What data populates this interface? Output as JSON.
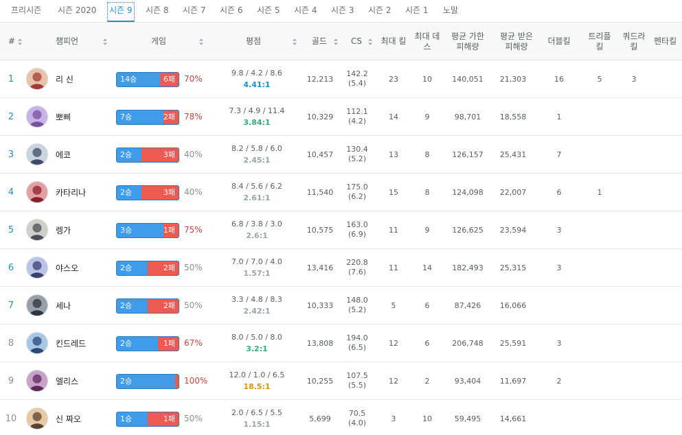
{
  "tabs": [
    {
      "label": "프리시즌",
      "active": false
    },
    {
      "label": "시즌 2020",
      "active": false
    },
    {
      "label": "시즌 9",
      "active": true
    },
    {
      "label": "시즌 8",
      "active": false
    },
    {
      "label": "시즌 7",
      "active": false
    },
    {
      "label": "시즌 6",
      "active": false
    },
    {
      "label": "시즌 5",
      "active": false
    },
    {
      "label": "시즌 4",
      "active": false
    },
    {
      "label": "시즌 3",
      "active": false
    },
    {
      "label": "시즌 2",
      "active": false
    },
    {
      "label": "시즌 1",
      "active": false
    },
    {
      "label": "노말",
      "active": false
    }
  ],
  "headers": {
    "rank": "#",
    "champion": "챔피언",
    "games": "게임",
    "rating": "평점",
    "gold": "골드",
    "cs": "CS",
    "max_kill": "최대 킬",
    "max_death": "최대 데스",
    "avg_dealt": "평균 가한 피해량",
    "avg_taken": "평균 받은 피해량",
    "double": "더블킬",
    "triple": "트리플킬",
    "quadra": "쿼드라킬",
    "penta": "펜타킬"
  },
  "icons": {
    "sort": "sort-arrows-icon"
  },
  "colors": {
    "accent": "#1f8ecd",
    "win": "#3f9cea",
    "loss": "#ee5a52",
    "winrate_high": "#c6443e",
    "kda_green": "#2daf7f",
    "kda_orange": "#e19205"
  },
  "rows": [
    {
      "rank": "1",
      "champion": "리 신",
      "wins": 14,
      "losses": 6,
      "win_label": "14승",
      "loss_label": "6패",
      "winrate": "70%",
      "kda": "9.8 / 4.2 / 8.6",
      "ratio": "4.41:1",
      "ratio_color": "blue",
      "gold": "12,213",
      "cs": "142.2",
      "cs_per_min": "(5.4)",
      "max_kill": "23",
      "max_death": "10",
      "avg_dealt": "140,051",
      "avg_taken": "21,303",
      "double": "16",
      "triple": "5",
      "quadra": "3",
      "penta": ""
    },
    {
      "rank": "2",
      "champion": "뽀삐",
      "wins": 7,
      "losses": 2,
      "win_label": "7승",
      "loss_label": "2패",
      "winrate": "78%",
      "kda": "7.3 / 4.9 / 11.4",
      "ratio": "3.84:1",
      "ratio_color": "green",
      "gold": "10,329",
      "cs": "112.1",
      "cs_per_min": "(4.2)",
      "max_kill": "14",
      "max_death": "9",
      "avg_dealt": "98,701",
      "avg_taken": "18,558",
      "double": "1",
      "triple": "",
      "quadra": "",
      "penta": ""
    },
    {
      "rank": "3",
      "champion": "에코",
      "wins": 2,
      "losses": 3,
      "win_label": "2승",
      "loss_label": "3패",
      "winrate": "40%",
      "kda": "8.2 / 5.8 / 6.0",
      "ratio": "2.45:1",
      "ratio_color": "gray",
      "gold": "10,457",
      "cs": "130.4",
      "cs_per_min": "(5.2)",
      "max_kill": "13",
      "max_death": "8",
      "avg_dealt": "126,157",
      "avg_taken": "25,431",
      "double": "7",
      "triple": "",
      "quadra": "",
      "penta": ""
    },
    {
      "rank": "4",
      "champion": "카타리나",
      "wins": 2,
      "losses": 3,
      "win_label": "2승",
      "loss_label": "3패",
      "winrate": "40%",
      "kda": "8.4 / 5.6 / 6.2",
      "ratio": "2.61:1",
      "ratio_color": "gray",
      "gold": "11,540",
      "cs": "175.0",
      "cs_per_min": "(6.2)",
      "max_kill": "15",
      "max_death": "8",
      "avg_dealt": "124,098",
      "avg_taken": "22,007",
      "double": "6",
      "triple": "1",
      "quadra": "",
      "penta": ""
    },
    {
      "rank": "5",
      "champion": "렝가",
      "wins": 3,
      "losses": 1,
      "win_label": "3승",
      "loss_label": "1패",
      "winrate": "75%",
      "kda": "6.8 / 3.8 / 3.0",
      "ratio": "2.6:1",
      "ratio_color": "gray",
      "gold": "10,575",
      "cs": "163.0",
      "cs_per_min": "(6.9)",
      "max_kill": "11",
      "max_death": "9",
      "avg_dealt": "126,625",
      "avg_taken": "23,594",
      "double": "3",
      "triple": "",
      "quadra": "",
      "penta": ""
    },
    {
      "rank": "6",
      "champion": "야스오",
      "wins": 2,
      "losses": 2,
      "win_label": "2승",
      "loss_label": "2패",
      "winrate": "50%",
      "kda": "7.0 / 7.0 / 4.0",
      "ratio": "1.57:1",
      "ratio_color": "gray",
      "gold": "13,416",
      "cs": "220.8",
      "cs_per_min": "(7.6)",
      "max_kill": "11",
      "max_death": "14",
      "avg_dealt": "182,493",
      "avg_taken": "25,315",
      "double": "3",
      "triple": "",
      "quadra": "",
      "penta": ""
    },
    {
      "rank": "7",
      "champion": "세나",
      "wins": 2,
      "losses": 2,
      "win_label": "2승",
      "loss_label": "2패",
      "winrate": "50%",
      "kda": "3.3 / 4.8 / 8.3",
      "ratio": "2.42:1",
      "ratio_color": "gray",
      "gold": "10,333",
      "cs": "148.0",
      "cs_per_min": "(5.2)",
      "max_kill": "5",
      "max_death": "6",
      "avg_dealt": "87,426",
      "avg_taken": "16,066",
      "double": "",
      "triple": "",
      "quadra": "",
      "penta": ""
    },
    {
      "rank": "8",
      "champion": "킨드레드",
      "wins": 2,
      "losses": 1,
      "win_label": "2승",
      "loss_label": "1패",
      "winrate": "67%",
      "kda": "8.0 / 5.0 / 8.0",
      "ratio": "3.2:1",
      "ratio_color": "green",
      "gold": "13,808",
      "cs": "194.0",
      "cs_per_min": "(6.5)",
      "max_kill": "12",
      "max_death": "6",
      "avg_dealt": "206,748",
      "avg_taken": "25,591",
      "double": "3",
      "triple": "",
      "quadra": "",
      "penta": ""
    },
    {
      "rank": "9",
      "champion": "엘리스",
      "wins": 2,
      "losses": 0,
      "win_label": "2승",
      "loss_label": "",
      "winrate": "100%",
      "kda": "12.0 / 1.0 / 6.5",
      "ratio": "18.5:1",
      "ratio_color": "orange",
      "gold": "10,255",
      "cs": "107.5",
      "cs_per_min": "(5.5)",
      "max_kill": "12",
      "max_death": "2",
      "avg_dealt": "93,404",
      "avg_taken": "11,697",
      "double": "2",
      "triple": "",
      "quadra": "",
      "penta": ""
    },
    {
      "rank": "10",
      "champion": "신 짜오",
      "wins": 1,
      "losses": 1,
      "win_label": "1승",
      "loss_label": "1패",
      "winrate": "50%",
      "kda": "2.0 / 6.5 / 5.5",
      "ratio": "1.15:1",
      "ratio_color": "gray",
      "gold": "5,699",
      "cs": "70.5",
      "cs_per_min": "(4.0)",
      "max_kill": "3",
      "max_death": "10",
      "avg_dealt": "59,495",
      "avg_taken": "14,661",
      "double": "",
      "triple": "",
      "quadra": "",
      "penta": ""
    }
  ]
}
